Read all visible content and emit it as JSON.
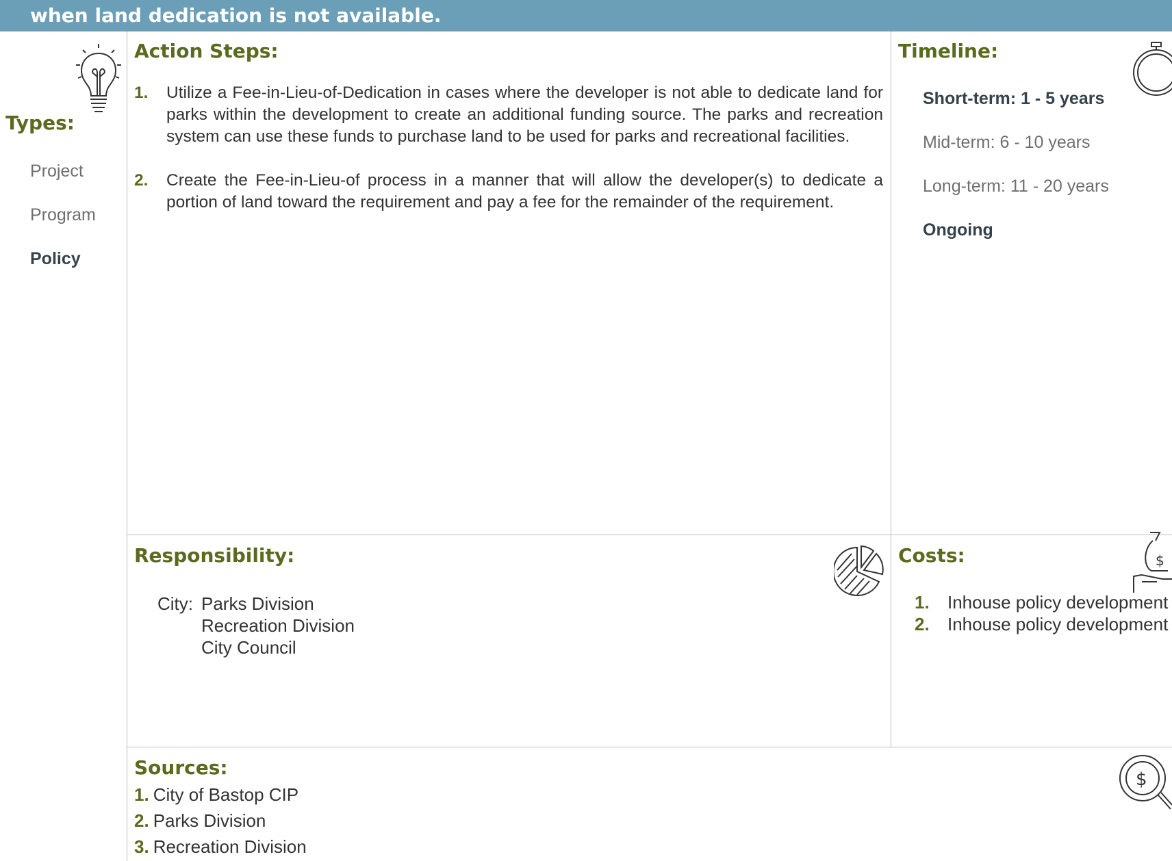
{
  "banner": {
    "text": "when land dedication is not available."
  },
  "types": {
    "heading": "Types:",
    "items": [
      {
        "label": "Project",
        "active": false
      },
      {
        "label": "Program",
        "active": false
      },
      {
        "label": "Policy",
        "active": true
      }
    ]
  },
  "action_steps": {
    "heading": "Action Steps:",
    "items": [
      {
        "num": "1.",
        "text": "Utilize a Fee-in-Lieu-of-Dedication in cases where the developer is not able to dedicate land for parks within the development to create an additional funding source. The parks and recreation system can use these funds to purchase land to be used for parks and recreational facilities."
      },
      {
        "num": "2.",
        "text": "Create the Fee-in-Lieu-of process in a manner that will allow the developer(s) to dedicate a portion of land toward the requirement and pay a fee for the remainder of the requirement."
      }
    ]
  },
  "timeline": {
    "heading": "Timeline:",
    "items": [
      {
        "label": "Short-term:  1 - 5 years",
        "active": true
      },
      {
        "label": "Mid-term:  6 - 10 years",
        "active": false
      },
      {
        "label": "Long-term:  11 - 20 years",
        "active": false
      },
      {
        "label": "Ongoing",
        "active": true
      }
    ]
  },
  "responsibility": {
    "heading": "Responsibility:",
    "prefix": "City:",
    "items": [
      "Parks Division",
      "Recreation Division",
      "City Council"
    ]
  },
  "costs": {
    "heading": "Costs:",
    "items": [
      {
        "num": "1.",
        "text": "Inhouse policy development"
      },
      {
        "num": "2.",
        "text": "Inhouse policy development"
      }
    ]
  },
  "sources": {
    "heading": "Sources:",
    "items": [
      {
        "num": "1.",
        "text": "City of Bastop CIP"
      },
      {
        "num": "2.",
        "text": "Parks Division"
      },
      {
        "num": "3.",
        "text": "Recreation Division"
      }
    ]
  },
  "colors": {
    "banner": "#6a9fb7",
    "heading": "#5a6b1f",
    "active_text": "#35424c",
    "inactive_text": "#6f6f6f"
  },
  "icons": [
    "lightbulb-icon",
    "stopwatch-icon",
    "pie-chart-icon",
    "money-bag-hand-icon",
    "dollar-search-icon"
  ]
}
